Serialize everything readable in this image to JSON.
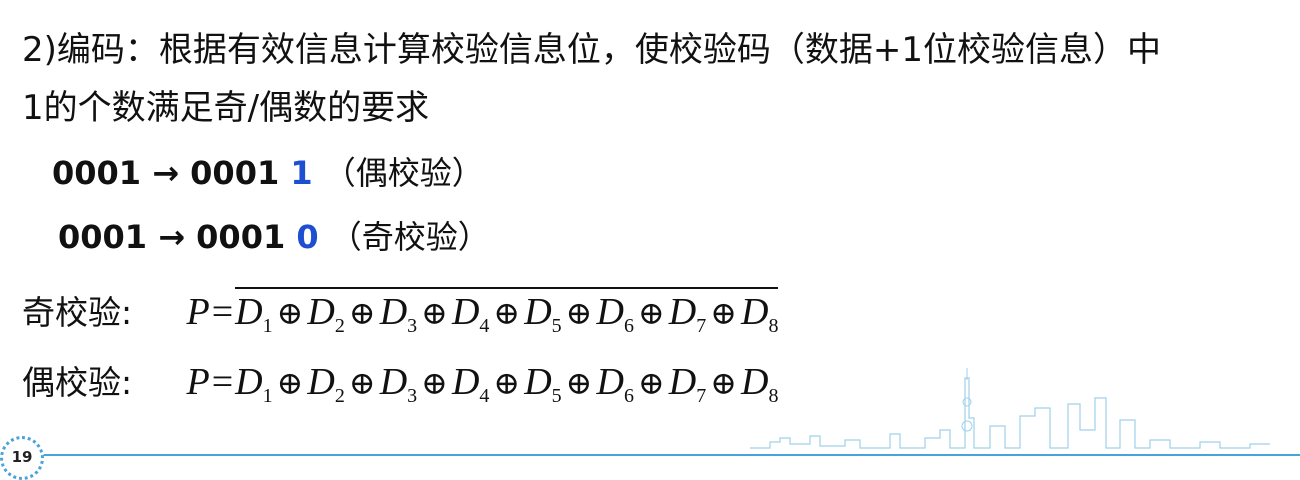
{
  "title": {
    "line1": "2)编码：根据有效信息计算校验信息位，使校验码（数据+1位校验信息）中",
    "line2": "1的个数满足奇/偶数的要求"
  },
  "examples": [
    {
      "data": "0001",
      "arrow": "→",
      "code": "0001",
      "bit": "1",
      "label": "（偶校验）"
    },
    {
      "data": "0001",
      "arrow": "→",
      "code": "0001",
      "bit": "0",
      "label": "（奇校验）"
    }
  ],
  "formulas": [
    {
      "label": "奇校验:",
      "lhs": "P",
      "eq": "=",
      "terms": [
        {
          "var": "D",
          "sub": "1"
        },
        {
          "var": "D",
          "sub": "2"
        },
        {
          "var": "D",
          "sub": "3"
        },
        {
          "var": "D",
          "sub": "4"
        },
        {
          "var": "D",
          "sub": "5"
        },
        {
          "var": "D",
          "sub": "6"
        },
        {
          "var": "D",
          "sub": "7"
        },
        {
          "var": "D",
          "sub": "8"
        }
      ],
      "op": "⊕",
      "overline": true
    },
    {
      "label": "偶校验:",
      "lhs": "P",
      "eq": "=",
      "terms": [
        {
          "var": "D",
          "sub": "1"
        },
        {
          "var": "D",
          "sub": "2"
        },
        {
          "var": "D",
          "sub": "3"
        },
        {
          "var": "D",
          "sub": "4"
        },
        {
          "var": "D",
          "sub": "5"
        },
        {
          "var": "D",
          "sub": "6"
        },
        {
          "var": "D",
          "sub": "7"
        },
        {
          "var": "D",
          "sub": "8"
        }
      ],
      "op": "⊕",
      "overline": false
    }
  ],
  "page_number": "19",
  "colors": {
    "accent": "#1f4fd1",
    "footer": "#4aa3d8"
  }
}
